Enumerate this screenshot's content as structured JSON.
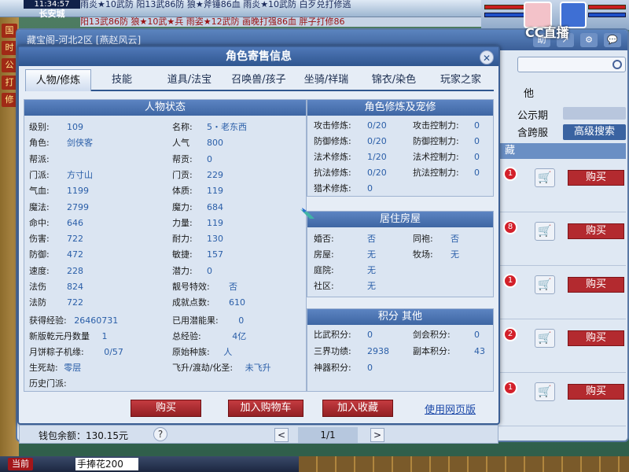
{
  "hud": {
    "clock": "11:34:57",
    "scene": "长安城",
    "chat_line1": "雨炎★10武防   阳13武86防   狼★斧锤86血   雨炎★10武防   白歹兑打修逃",
    "chat_line2": "阳13武86防   狼★10武★兵   雨姿★12武防   画晚打强86血   胖子打修86",
    "left_tags": [
      "国",
      "时",
      "公",
      "打",
      "修"
    ],
    "cc_logo": "CC直播"
  },
  "store": {
    "title": "藏宝阁-河北2区 [燕赵风云]",
    "icons": [
      "助",
      "↗",
      "⚙",
      "💬"
    ],
    "search_placeholder": "",
    "filter_other": "他",
    "filter_public": "公示期",
    "filter_cross": "含跨服",
    "advanced_search": "高级搜索",
    "list_header": "藏",
    "items": [
      {
        "badge": "1",
        "buy": "购买"
      },
      {
        "badge": "8",
        "buy": "购买"
      },
      {
        "badge": "1",
        "buy": "购买"
      },
      {
        "badge": "2",
        "buy": "购买"
      },
      {
        "badge": "1",
        "buy": "购买"
      }
    ]
  },
  "dialog": {
    "title": "角色寄售信息",
    "close": "✕",
    "tabs": [
      "人物/修炼",
      "技能",
      "道具/法宝",
      "召唤兽/孩子",
      "坐骑/祥瑞",
      "锦衣/染色",
      "玩家之家"
    ],
    "status": {
      "header": "人物状态",
      "left": [
        {
          "k": "级别:",
          "v": "109"
        },
        {
          "k": "角色:",
          "v": "剑侠客"
        },
        {
          "k": "帮派:",
          "v": ""
        },
        {
          "k": "门派:",
          "v": "方寸山"
        },
        {
          "k": "气血:",
          "v": "1199"
        },
        {
          "k": "魔法:",
          "v": "2799"
        },
        {
          "k": "命中:",
          "v": "646"
        },
        {
          "k": "伤害:",
          "v": "722"
        },
        {
          "k": "防御:",
          "v": "472"
        },
        {
          "k": "速度:",
          "v": "228"
        },
        {
          "k": "法伤",
          "v": "824"
        },
        {
          "k": "法防",
          "v": "722"
        }
      ],
      "right": [
        {
          "k": "名称:",
          "v": "5・老东西"
        },
        {
          "k": "人气",
          "v": "800"
        },
        {
          "k": "帮贡:",
          "v": "0"
        },
        {
          "k": "门贡:",
          "v": "229"
        },
        {
          "k": "体质:",
          "v": "119"
        },
        {
          "k": "魔力:",
          "v": "684"
        },
        {
          "k": "力量:",
          "v": "119"
        },
        {
          "k": "耐力:",
          "v": "130"
        },
        {
          "k": "敏捷:",
          "v": "157"
        },
        {
          "k": "潜力:",
          "v": "0"
        },
        {
          "k": "靓号特效:",
          "v": "否"
        },
        {
          "k": "成就点数:",
          "v": "610"
        }
      ],
      "exp": {
        "k": "获得经验:",
        "v": "26460731"
      },
      "used_pot": {
        "k": "已用潜能果:",
        "v": "0"
      },
      "pill": {
        "k": "新版乾元丹数量",
        "v": "1"
      },
      "total_exp": {
        "k": "总经验:",
        "v": "4亿"
      },
      "zongzi": {
        "k": "月饼粽子机缘:",
        "v": "0/57"
      },
      "race": {
        "k": "原始种族:",
        "v": "人"
      },
      "life": {
        "k": "生死劫:",
        "v": "零层"
      },
      "ascend": {
        "k": "飞升/渡劫/化圣:",
        "v": "未飞升"
      },
      "history": {
        "k": "历史门派:",
        "v": ""
      }
    },
    "cultivation": {
      "header": "角色修炼及宠修",
      "rows": [
        {
          "k1": "攻击修炼:",
          "v1": "0/20",
          "k2": "攻击控制力:",
          "v2": "0"
        },
        {
          "k1": "防御修炼:",
          "v1": "0/20",
          "k2": "防御控制力:",
          "v2": "0"
        },
        {
          "k1": "法术修炼:",
          "v1": "1/20",
          "k2": "法术控制力:",
          "v2": "0"
        },
        {
          "k1": "抗法修炼:",
          "v1": "0/20",
          "k2": "抗法控制力:",
          "v2": "0"
        },
        {
          "k1": "猎术修炼:",
          "v1": "0",
          "k2": "",
          "v2": ""
        }
      ]
    },
    "housing": {
      "header": "居住房屋",
      "rows": [
        {
          "k1": "婚否:",
          "v1": "否",
          "k2": "同袍:",
          "v2": "否"
        },
        {
          "k1": "房屋:",
          "v1": "无",
          "k2": "牧场:",
          "v2": "无"
        },
        {
          "k1": "庭院:",
          "v1": "无",
          "k2": "",
          "v2": ""
        },
        {
          "k1": "社区:",
          "v1": "无",
          "k2": "",
          "v2": ""
        }
      ]
    },
    "points": {
      "header": "积分 其他",
      "rows": [
        {
          "k1": "比武积分:",
          "v1": "0",
          "k2": "剑会积分:",
          "v2": "0"
        },
        {
          "k1": "三界功绩:",
          "v1": "2938",
          "k2": "副本积分:",
          "v2": "43"
        },
        {
          "k1": "神器积分:",
          "v1": "0",
          "k2": "",
          "v2": ""
        }
      ]
    },
    "buttons": {
      "buy": "购买",
      "add_cart": "加入购物车",
      "add_fav": "加入收藏",
      "web_link": "使用网页版"
    }
  },
  "footer": {
    "wallet": "钱包余额：130.15元",
    "help": "?",
    "prev": "<",
    "page": "1/1",
    "next": ">"
  },
  "bottom": {
    "btn": "当前",
    "chat_input": "手捧花200"
  }
}
